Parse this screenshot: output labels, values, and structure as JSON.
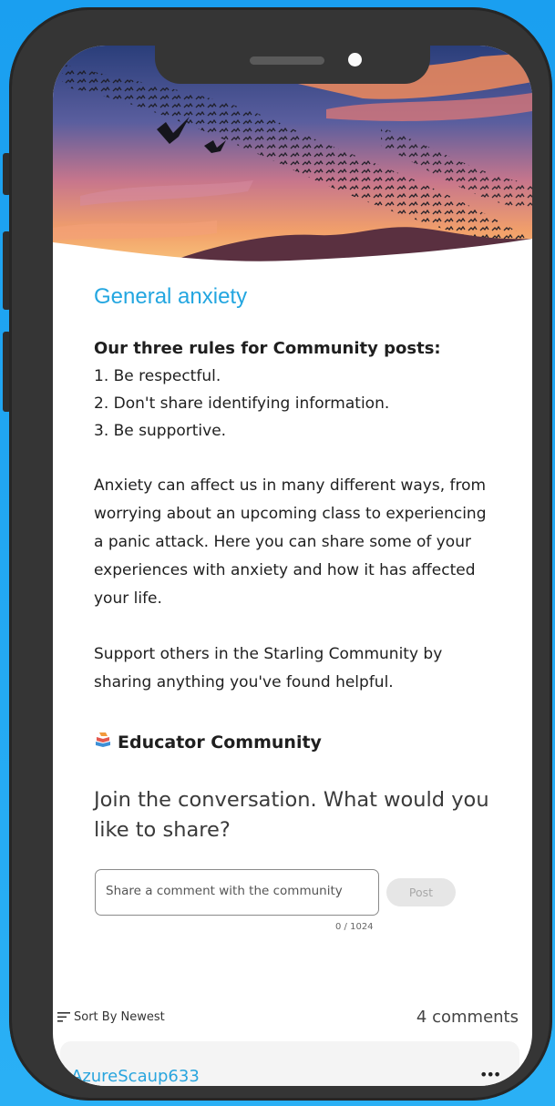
{
  "topic": {
    "title": "General anxiety",
    "rules_heading": "Our three rules for Community posts:",
    "rules": [
      "1. Be respectful.",
      "2. Don't share identifying information.",
      "3. Be supportive."
    ],
    "description": "Anxiety can affect us in many different ways, from worrying about an upcoming class to experiencing a panic attack. Here you can share some of your experiences with anxiety and how it has affected your life.",
    "support": "Support others in the Starling Community by sharing anything you've found helpful.",
    "community_label": "Educator Community",
    "community_icon": "book-stack-icon"
  },
  "composer": {
    "prompt": "Join the conversation. What would you like to share?",
    "placeholder": "Share a comment with the community",
    "post_label": "Post",
    "char_counter": "0 / 1024"
  },
  "comments": {
    "sort_label": "Sort By Newest",
    "count_label": "4 comments",
    "items": [
      {
        "username": "AzureScaup633",
        "more": "•••"
      }
    ]
  },
  "colors": {
    "accent": "#23a6e0",
    "frame": "#353535",
    "background": "#1a9ff0"
  }
}
